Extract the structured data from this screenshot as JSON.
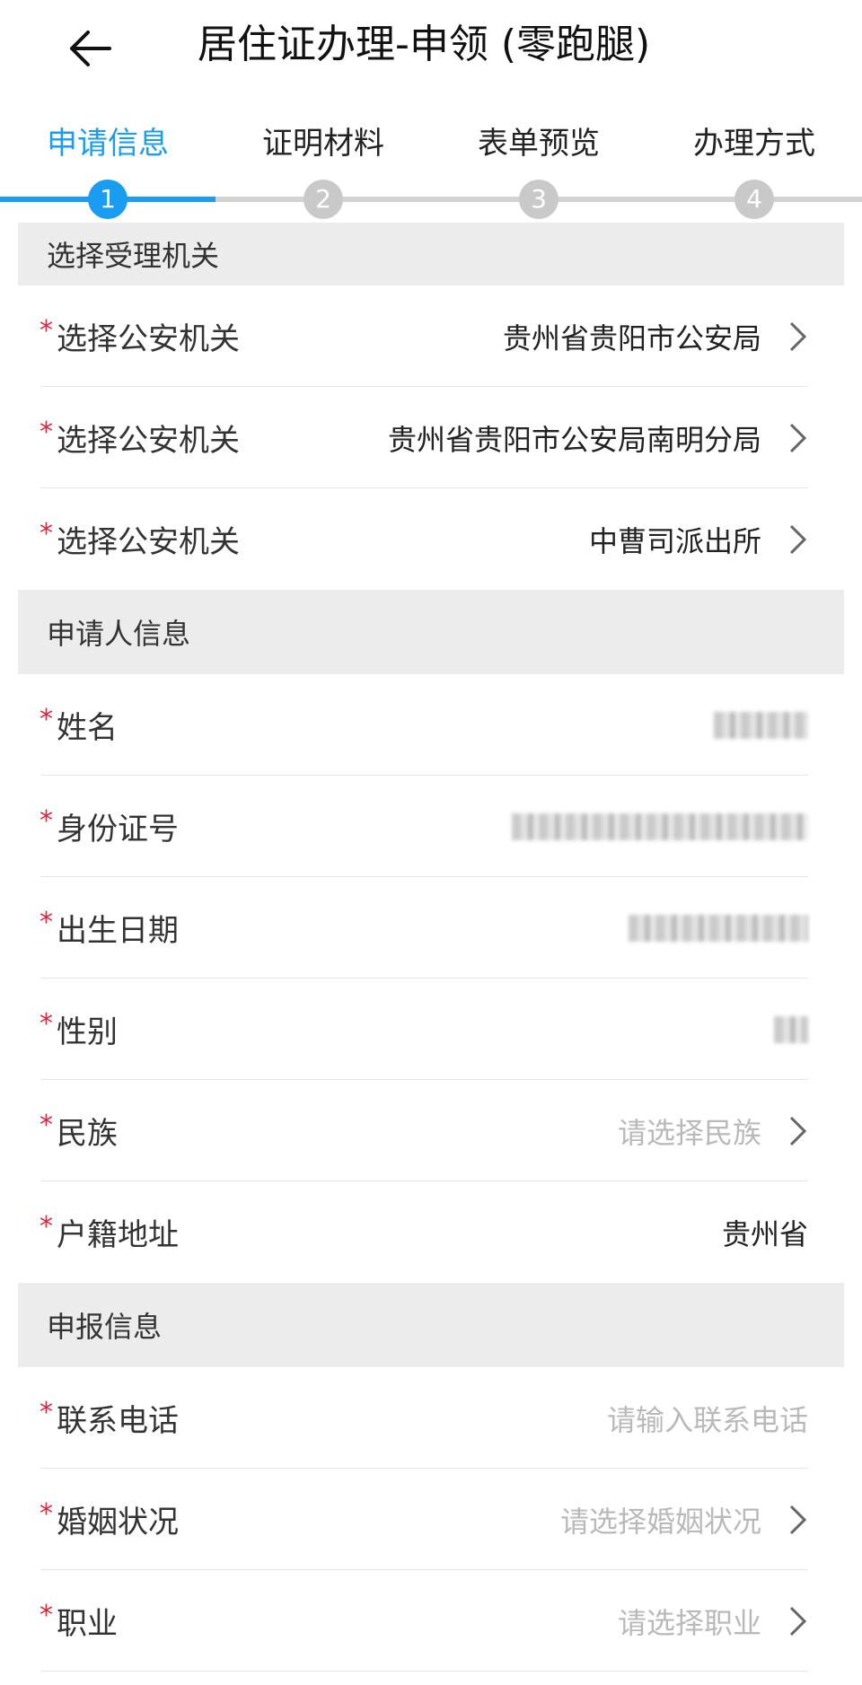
{
  "header": {
    "title": "居住证办理-申领 (零跑腿)",
    "back_icon": "arrow-left-icon"
  },
  "steps": [
    {
      "label": "申请信息",
      "number": "1",
      "active": true
    },
    {
      "label": "证明材料",
      "number": "2",
      "active": false
    },
    {
      "label": "表单预览",
      "number": "3",
      "active": false
    },
    {
      "label": "办理方式",
      "number": "4",
      "active": false
    }
  ],
  "colors": {
    "accent": "#1a9cf0",
    "required": "#e5223a",
    "section_bg": "#ececec",
    "placeholder": "#b9b9b9"
  },
  "section_agency": {
    "title": "选择受理机关",
    "rows": [
      {
        "label": "选择公安机关",
        "value": "贵州省贵阳市公安局"
      },
      {
        "label": "选择公安机关",
        "value": "贵州省贵阳市公安局南明分局"
      },
      {
        "label": "选择公安机关",
        "value": "中曹司派出所"
      }
    ]
  },
  "section_applicant": {
    "title": "申请人信息",
    "rows": [
      {
        "label": "姓名"
      },
      {
        "label": "身份证号"
      },
      {
        "label": "出生日期"
      },
      {
        "label": "性别"
      },
      {
        "label": "民族",
        "placeholder": "请选择民族"
      },
      {
        "label": "户籍地址",
        "value": "贵州省"
      }
    ]
  },
  "section_report": {
    "title": "申报信息",
    "rows": [
      {
        "label": "联系电话",
        "placeholder": "请输入联系电话"
      },
      {
        "label": "婚姻状况",
        "placeholder": "请选择婚姻状况"
      },
      {
        "label": "职业",
        "placeholder": "请选择职业"
      }
    ]
  },
  "required_mark": "*"
}
